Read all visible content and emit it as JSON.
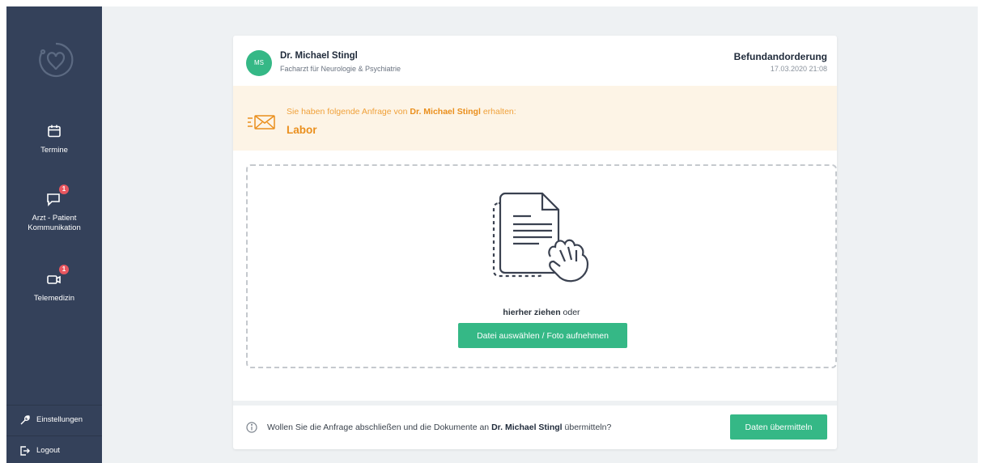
{
  "sidebar": {
    "logo_icon": "heart-stethoscope-icon",
    "items": [
      {
        "label": "Termine",
        "icon": "calendar-icon",
        "badge": ""
      },
      {
        "label_line1": "Arzt - Patient",
        "label_line2": "Kommunikation",
        "icon": "chat-icon",
        "badge": "1"
      },
      {
        "label": "Telemedizin",
        "icon": "video-icon",
        "badge": "1"
      }
    ],
    "bottom": [
      {
        "label": "Einstellungen",
        "icon": "wrench-icon"
      },
      {
        "label": "Logout",
        "icon": "logout-icon"
      }
    ]
  },
  "request": {
    "avatar_initials": "MS",
    "doctor_name": "Dr. Michael Stingl",
    "doctor_title": "Facharzt für Neurologie & Psychiatrie",
    "title": "Befundandorderung",
    "date": "17.03.2020 21:08"
  },
  "notice": {
    "icon": "mail-send-icon",
    "text_prefix": "Sie haben folgende Anfrage von ",
    "text_name": "Dr. Michael Stingl",
    "text_suffix": " erhalten:",
    "subject": "Labor"
  },
  "dropzone": {
    "illustration": "document-drag-icon",
    "drag_bold": "hierher ziehen",
    "drag_rest": " oder",
    "button_label": "Datei auswählen / Foto aufnehmen"
  },
  "footer": {
    "icon": "info-icon",
    "text_prefix": "Wollen Sie die Anfrage abschließen und die Dokumente an ",
    "text_name": "Dr. Michael Stingl",
    "text_suffix": " übermitteln?",
    "button_label": "Daten übermitteln"
  },
  "colors": {
    "sidebar": "#34415a",
    "accent_green": "#35b886",
    "notice_bg": "#fdf4e6",
    "notice_text": "#ea8f1d",
    "badge": "#e8565f"
  }
}
